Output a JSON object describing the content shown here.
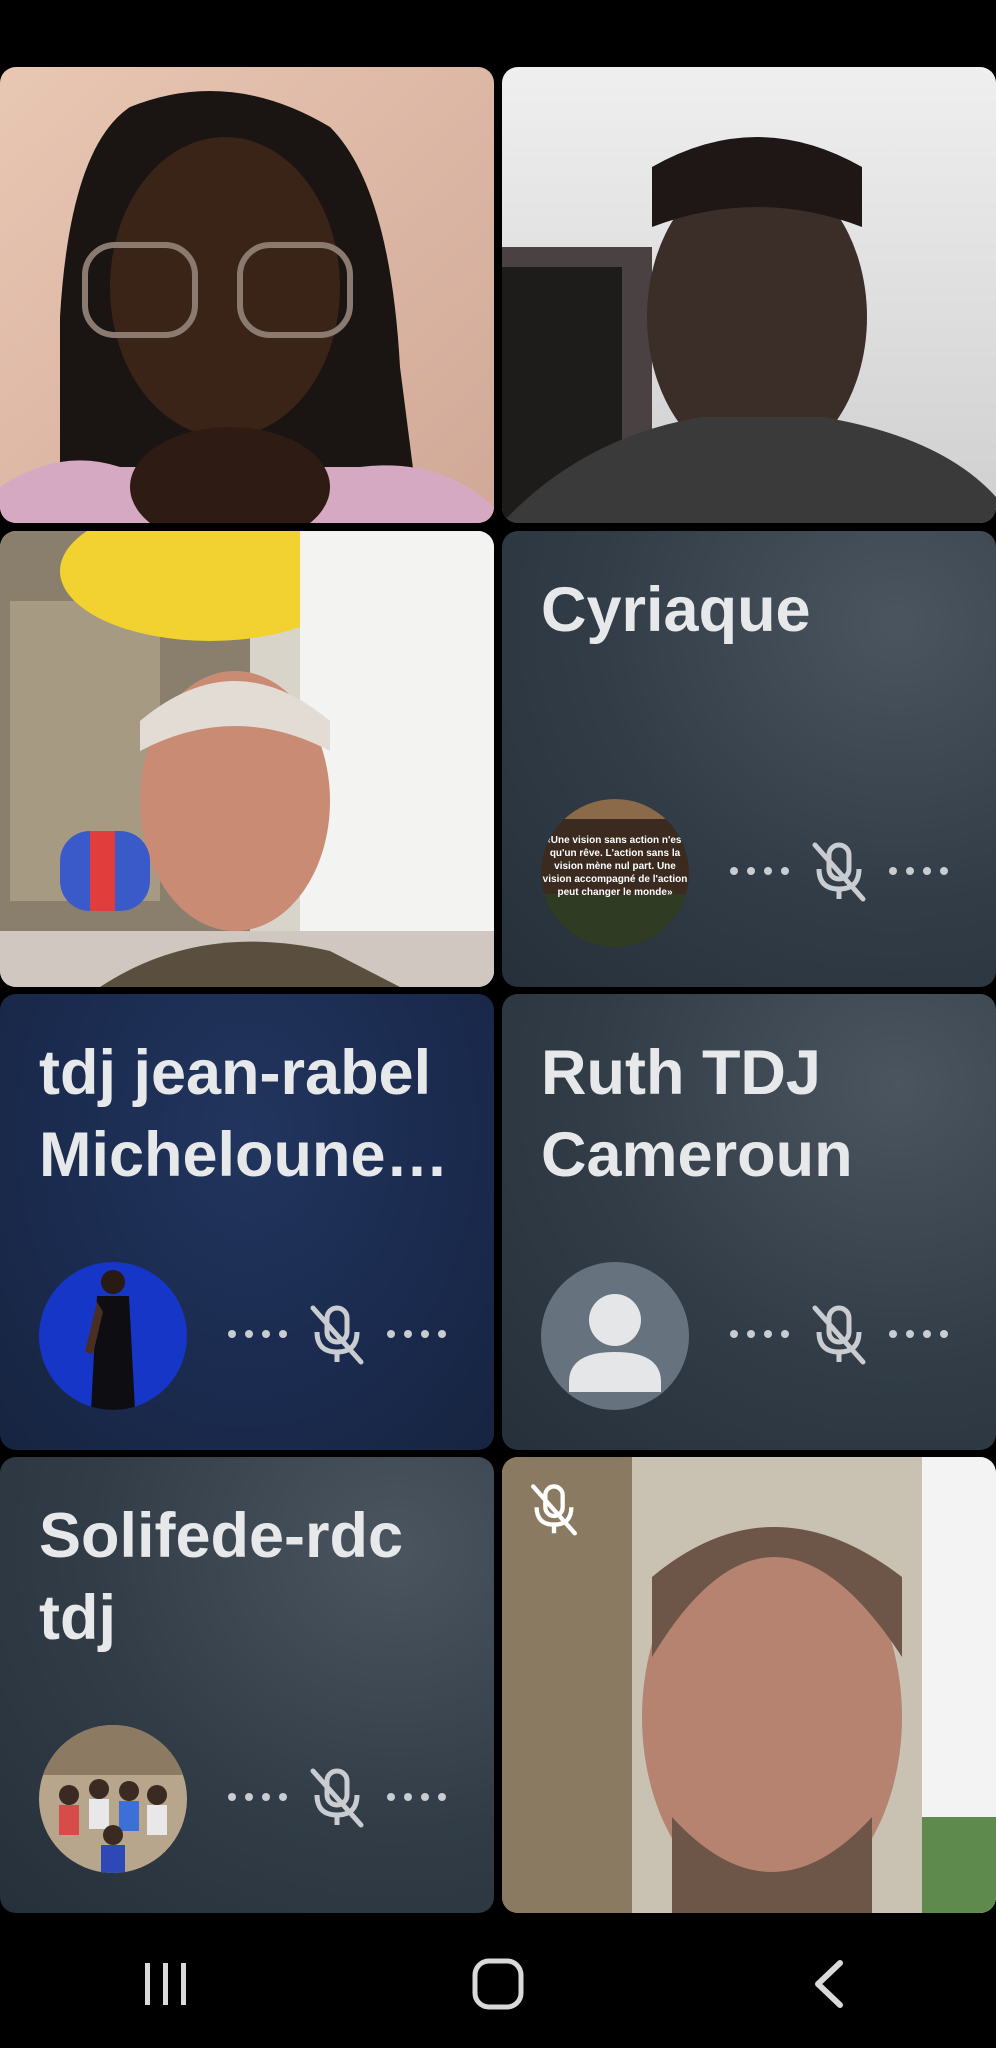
{
  "tiles": [
    {
      "id": "p1",
      "kind": "video",
      "muted": false
    },
    {
      "id": "p2",
      "kind": "video",
      "muted": false
    },
    {
      "id": "p3",
      "kind": "video",
      "muted": false
    },
    {
      "id": "p4",
      "kind": "avatar",
      "name": "Cyriaque",
      "avatar": "quote-image",
      "avatar_text": "«Une vision sans action n'est qu'un rêve. L'action sans la vision mène nul part. Une vision accompagné de l'action peut changer le monde»",
      "muted": true
    },
    {
      "id": "p5",
      "kind": "avatar",
      "name": "tdj jean-rabel Micheloune…",
      "avatar": "person-photo",
      "muted": true
    },
    {
      "id": "p6",
      "kind": "avatar",
      "name": "Ruth TDJ Cameroun",
      "avatar": "default-person",
      "muted": true
    },
    {
      "id": "p7",
      "kind": "avatar",
      "name": "Solifede-rdc tdj",
      "avatar": "group-photo",
      "muted": true
    },
    {
      "id": "p8",
      "kind": "video",
      "muted": true
    }
  ],
  "nav": {
    "recents": "recent-apps-icon",
    "home": "home-icon",
    "back": "back-icon"
  },
  "colors": {
    "background": "#000000",
    "avatar_tile": "#313c46",
    "blue_tile": "#1b2b4f",
    "text": "#e6e8ea",
    "icon": "#c9ccd0"
  }
}
